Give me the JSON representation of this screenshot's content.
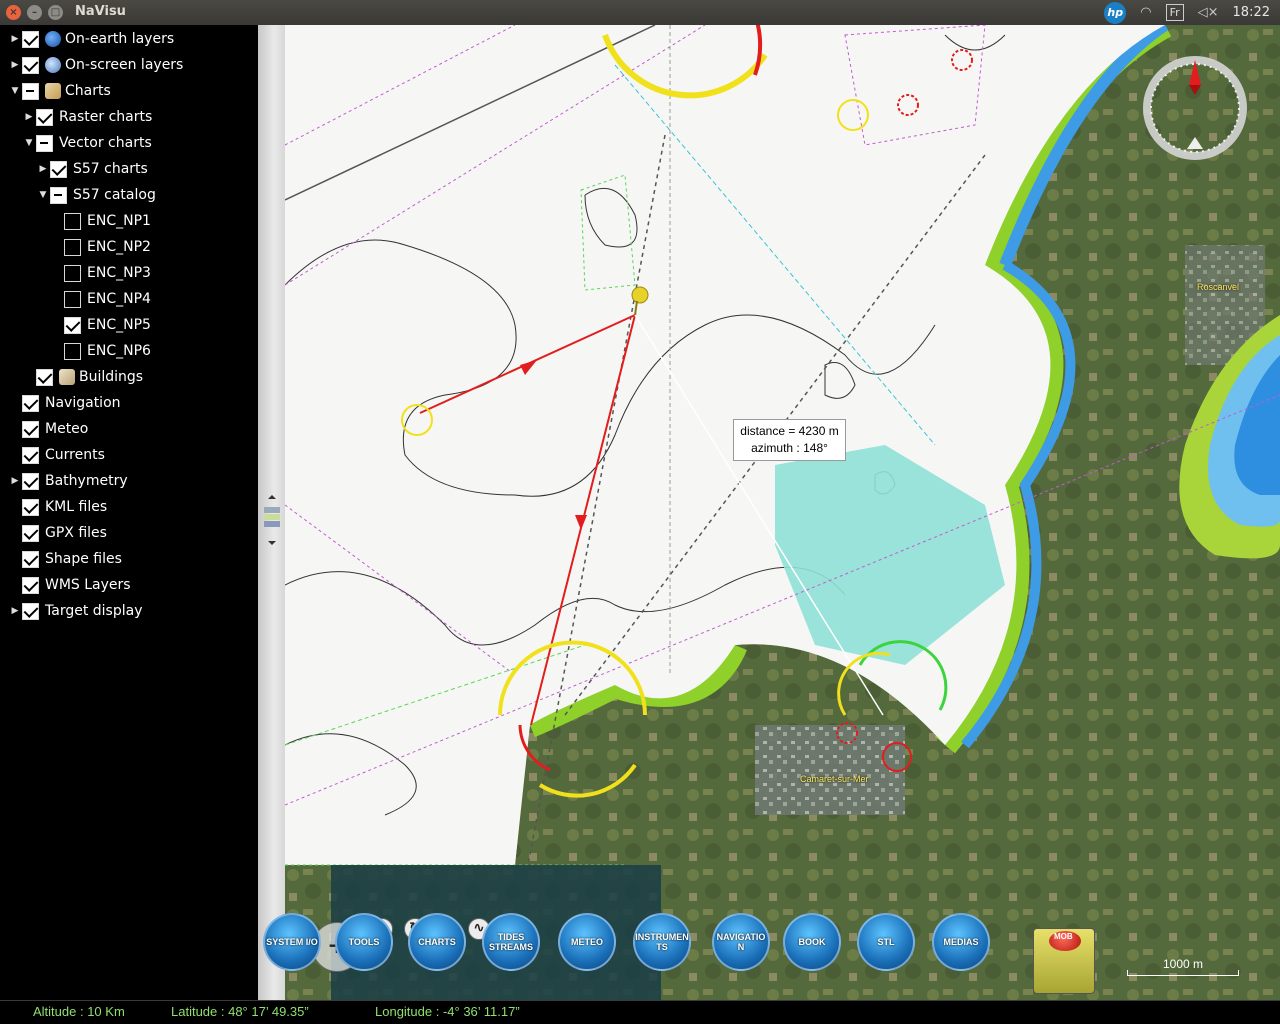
{
  "window": {
    "title": "NaVisu"
  },
  "tray": {
    "hp": "hp",
    "keyboard": "Fr",
    "clock": "18:22"
  },
  "tree": [
    {
      "label": "On-earth layers",
      "check": "on",
      "expander": "collapsed",
      "icon": "globe-icon"
    },
    {
      "label": "On-screen layers",
      "check": "on",
      "expander": "collapsed",
      "icon": "screen-icon"
    },
    {
      "label": "Charts",
      "check": "part",
      "expander": "expanded",
      "icon": "chart-icon"
    },
    {
      "label": "Raster charts",
      "check": "on",
      "expander": "collapsed"
    },
    {
      "label": "Vector charts",
      "check": "part",
      "expander": "expanded"
    },
    {
      "label": "S57 charts",
      "check": "on",
      "expander": "collapsed"
    },
    {
      "label": "S57 catalog",
      "check": "part",
      "expander": "expanded"
    },
    {
      "label": "ENC_NP1",
      "check": "off"
    },
    {
      "label": "ENC_NP2",
      "check": "off"
    },
    {
      "label": "ENC_NP3",
      "check": "off"
    },
    {
      "label": "ENC_NP4",
      "check": "off"
    },
    {
      "label": "ENC_NP5",
      "check": "on"
    },
    {
      "label": "ENC_NP6",
      "check": "off"
    },
    {
      "label": "Buildings",
      "check": "on",
      "icon": "building-icon"
    },
    {
      "label": "Navigation",
      "check": "on"
    },
    {
      "label": "Meteo",
      "check": "on"
    },
    {
      "label": "Currents",
      "check": "on"
    },
    {
      "label": "Bathymetry",
      "check": "on",
      "expander": "collapsed"
    },
    {
      "label": "KML files",
      "check": "on"
    },
    {
      "label": "GPX files",
      "check": "on"
    },
    {
      "label": "Shape files",
      "check": "on"
    },
    {
      "label": "WMS Layers",
      "check": "on"
    },
    {
      "label": "Target display",
      "check": "on",
      "expander": "collapsed"
    }
  ],
  "map": {
    "tooltip": {
      "distance": "distance = 4230 m",
      "azimuth": "azimuth : 148°"
    },
    "places": [
      "Roscanvel",
      "Camaret-sur-Mer"
    ],
    "scale_label": "1000 m"
  },
  "toolbar": {
    "buttons": [
      "SYSTEM I/O",
      "TOOLS",
      "CHARTS",
      "TIDES STREAMS",
      "METEO",
      "INSTRUMENTS",
      "NAVIGATION",
      "BOOK",
      "STL",
      "MEDIAS"
    ],
    "mob_label": "MOB"
  },
  "status": {
    "altitude": "Altitude : 10 Km",
    "latitude": "Latitude :   48° 17’ 49.35”",
    "longitude": "Longitude :   -4° 36’ 11.17”"
  }
}
